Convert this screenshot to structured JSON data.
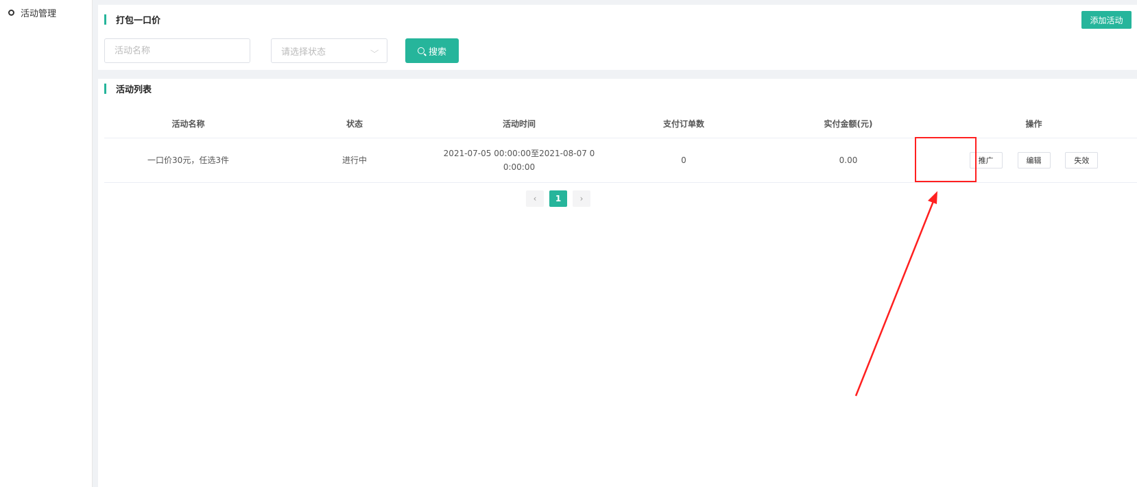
{
  "sidebar": {
    "items": [
      {
        "label": "活动管理",
        "icon": "circle-icon"
      }
    ]
  },
  "filter": {
    "title": "打包一口价",
    "add_button": "添加活动",
    "name_placeholder": "活动名称",
    "status_placeholder": "请选择状态",
    "search_button": "搜索"
  },
  "list": {
    "title": "活动列表",
    "columns": [
      "活动名称",
      "状态",
      "活动时间",
      "支付订单数",
      "实付金额(元)",
      "操作"
    ],
    "rows": [
      {
        "name": "一口价30元，任选3件",
        "status": "进行中",
        "time": "2021-07-05 00:00:00至2021-08-07 00:00:00",
        "orders": "0",
        "amount": "0.00",
        "actions": [
          "推广",
          "编辑",
          "失效"
        ]
      }
    ]
  },
  "pagination": {
    "prev": "‹",
    "current": "1",
    "next": "›"
  },
  "colors": {
    "accent": "#26b59b",
    "annotation": "#ff1f1f"
  }
}
